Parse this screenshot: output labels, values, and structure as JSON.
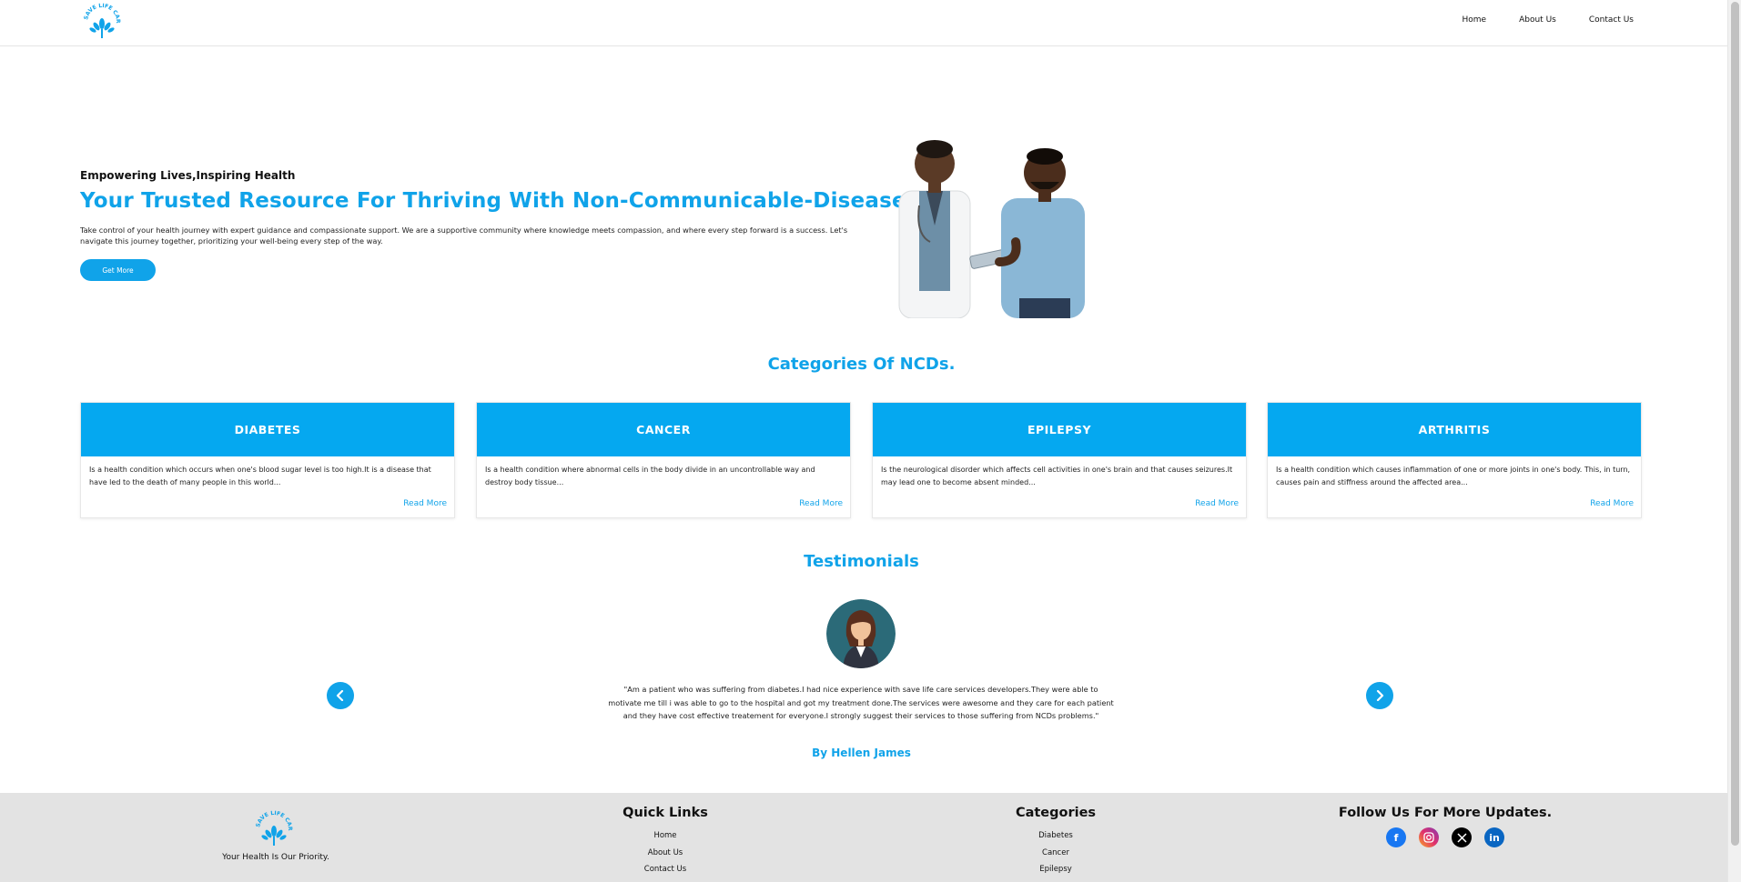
{
  "brand": {
    "logo_text": "SAVE LIFE CARE",
    "accent": "#10a3e9"
  },
  "nav": {
    "items": [
      {
        "label": "Home"
      },
      {
        "label": "About Us"
      },
      {
        "label": "Contact Us"
      }
    ]
  },
  "hero": {
    "eyebrow": "Empowering Lives,Inspiring Health",
    "title": "Your Trusted Resource For Thriving With Non-Communicable-Diseases.",
    "description": "Take control of your health journey with expert guidance and compassionate support. We are a supportive community where knowledge meets compassion, and where every step forward is a success. Let's navigate this journey together, prioritizing your well-being every step of the way.",
    "button_label": "Get More"
  },
  "categories": {
    "title": "Categories Of NCDs.",
    "cards": [
      {
        "name": "DIABETES",
        "description": "Is a health condition which occurs when one's blood sugar level is too high.It is a disease that have led to the death of many people in this world...",
        "link": "Read More"
      },
      {
        "name": "CANCER",
        "description": "Is a health condition where abnormal cells in the body divide in an uncontrollable way and destroy body tissue...",
        "link": "Read More"
      },
      {
        "name": "EPILEPSY",
        "description": "Is the neurological disorder which affects cell activities in one's brain and that causes seizures.It may lead one to become absent minded...",
        "link": "Read More"
      },
      {
        "name": "ARTHRITIS",
        "description": "Is a health condition which causes inflammation of one or more joints in one's body. This, in turn, causes pain and stiffness around the affected area...",
        "link": "Read More"
      }
    ]
  },
  "testimonials": {
    "title": "Testimonials",
    "quote": "\"Am a patient who was suffering from diabetes.I had nice experience with save life care services developers.They were able to motivate me till i was able to go to the hospital and got my treatment done.The services were awesome and they care for each patient and they have cost effective treatement for everyone.I strongly suggest their services to those suffering from NCDs problems.\"",
    "author": "By Hellen James"
  },
  "footer": {
    "tagline": "Your Health Is Our Priority.",
    "quick_links": {
      "title": "Quick Links",
      "items": [
        {
          "label": "Home"
        },
        {
          "label": "About Us"
        },
        {
          "label": "Contact Us"
        }
      ]
    },
    "categories": {
      "title": "Categories",
      "items": [
        {
          "label": "Diabetes"
        },
        {
          "label": "Cancer"
        },
        {
          "label": "Epilepsy"
        }
      ]
    },
    "follow": {
      "title": "Follow Us For More Updates.",
      "icons": [
        "facebook-icon",
        "instagram-icon",
        "x-twitter-icon",
        "linkedin-icon"
      ]
    }
  }
}
